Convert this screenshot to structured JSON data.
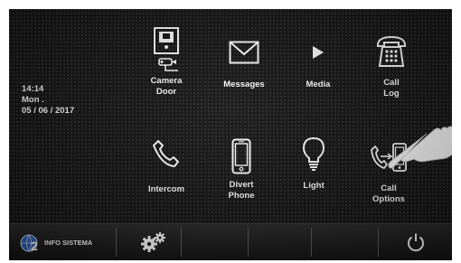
{
  "clock": {
    "time": "14:14",
    "day": "Mon .",
    "date": "05 / 06 / 2017"
  },
  "menu": {
    "row1": [
      {
        "id": "camera-door",
        "label": "Camera\nDoor",
        "icon": "camera-door-icon"
      },
      {
        "id": "messages",
        "label": "Messages",
        "icon": "envelope-icon"
      },
      {
        "id": "media",
        "label": "Media",
        "icon": "play-icon"
      },
      {
        "id": "call-log",
        "label": "Call\nLog",
        "icon": "telephone-icon"
      }
    ],
    "row2": [
      {
        "id": "intercom",
        "label": "Intercom",
        "icon": "handset-icon"
      },
      {
        "id": "divert-phone",
        "label": "Divert\nPhone",
        "icon": "smartphone-icon"
      },
      {
        "id": "light",
        "label": "Light",
        "icon": "lightbulb-icon"
      },
      {
        "id": "call-options",
        "label": "Call\nOptions",
        "icon": "call-transfer-icon"
      }
    ]
  },
  "bottom_bar": {
    "logo_text": "INFO SISTEMA",
    "logo_icon": "globe-logo-icon",
    "settings_icon": "gears-icon",
    "power_icon": "power-icon"
  },
  "colors": {
    "background": "#141414",
    "text": "#ffffff",
    "bar": "#1e1e1e"
  }
}
